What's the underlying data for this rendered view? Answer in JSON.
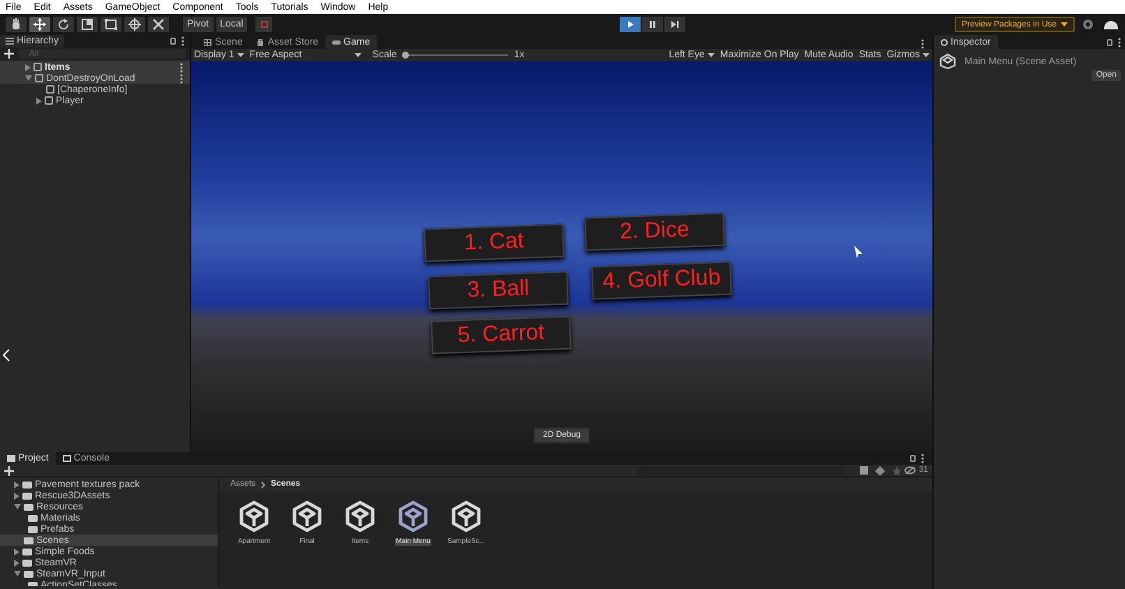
{
  "menu_bar": [
    "File",
    "Edit",
    "Assets",
    "GameObject",
    "Component",
    "Tools",
    "Tutorials",
    "Window",
    "Help"
  ],
  "toolbar": {
    "tools": [
      {
        "kind": "hand",
        "selected": false
      },
      {
        "kind": "move",
        "selected": true
      },
      {
        "kind": "rotate",
        "selected": false
      },
      {
        "kind": "scale",
        "selected": false
      },
      {
        "kind": "rect",
        "selected": false
      },
      {
        "kind": "transform",
        "selected": false
      },
      {
        "kind": "custom",
        "selected": false
      }
    ],
    "pivot": "Pivot",
    "local": "Local",
    "play": [
      {
        "kind": "play",
        "selected": true
      },
      {
        "kind": "pause",
        "selected": false
      },
      {
        "kind": "step",
        "selected": false
      }
    ],
    "packages": "Preview Packages in Use"
  },
  "hierarchy": {
    "title": "Hierarchy",
    "search_placeholder": "All",
    "items": [
      {
        "label": "Items",
        "bold": true,
        "expanded": false
      },
      {
        "label": "DontDestroyOnLoad",
        "bold": false,
        "expanded": true,
        "children": [
          {
            "label": "[ChaperoneInfo]",
            "bold": false
          },
          {
            "label": "Player",
            "bold": false,
            "expanded": false
          }
        ]
      }
    ]
  },
  "center_tabs": [
    {
      "label": "Scene",
      "selected": false
    },
    {
      "label": "Asset Store",
      "selected": false
    },
    {
      "label": "Game",
      "selected": true
    }
  ],
  "game_toolbar": {
    "display": "Display 1",
    "aspect": "Free Aspect",
    "scale_label": "Scale",
    "level": 0.0,
    "scale_value": "1x",
    "eye": "Left Eye",
    "buttons": [
      "Maximize On Play",
      "Mute Audio",
      "Stats",
      "Gizmos"
    ]
  },
  "game_view": {
    "signs": [
      "1. Cat",
      "2. Dice",
      "3. Ball",
      "4. Golf Club",
      "5. Carrot"
    ],
    "debug_button": "2D Debug"
  },
  "inspector": {
    "title": "Inspector",
    "asset": "Main Menu (Scene Asset)",
    "open_button": "Open"
  },
  "bottom_tabs": [
    {
      "label": "Project",
      "selected": true
    },
    {
      "label": "Console",
      "selected": false
    }
  ],
  "project_tree": [
    {
      "label": "Pavement textures pack",
      "expanded": false,
      "selected": false
    },
    {
      "label": "Rescue3DAssets",
      "expanded": false,
      "selected": false
    },
    {
      "label": "Resources",
      "expanded": true,
      "selected": false,
      "children": [
        {
          "label": "Materials",
          "selected": false
        },
        {
          "label": "Prefabs",
          "selected": false
        }
      ]
    },
    {
      "label": "Scenes",
      "selected": true
    },
    {
      "label": "Simple Foods",
      "expanded": false,
      "selected": false
    },
    {
      "label": "SteamVR",
      "expanded": false,
      "selected": false
    },
    {
      "label": "SteamVR_Input",
      "expanded": true,
      "selected": false,
      "children": [
        {
          "label": "ActionSetClasses",
          "selected": false
        }
      ]
    }
  ],
  "breadcrumb": [
    "Assets",
    "Scenes"
  ],
  "hidden_count": "31",
  "assets": [
    {
      "label": "Apartment",
      "selected": false
    },
    {
      "label": "Final",
      "selected": false
    },
    {
      "label": "Items",
      "selected": false
    },
    {
      "label": "Main Menu",
      "selected": true
    },
    {
      "label": "SampleSc...",
      "selected": false
    }
  ]
}
